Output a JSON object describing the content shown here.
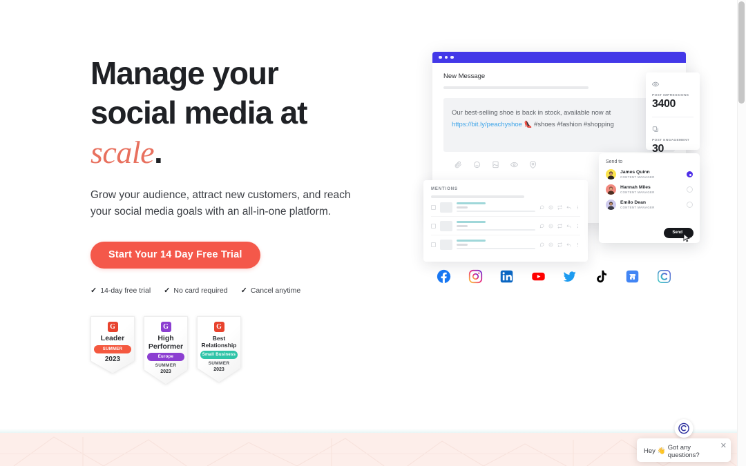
{
  "hero": {
    "headline_line1": "Manage your",
    "headline_line2": "social media at",
    "headline_accent": "scale",
    "headline_period": ".",
    "subhead": "Grow your audience, attract new customers, and reach your social media goals with an all-in-one platform.",
    "cta_label": "Start Your 14 Day Free Trial",
    "accent_color": "#f4584a",
    "accent_serif_color": "#e8705e",
    "trust_items": [
      {
        "check": "✓",
        "label": "14-day free trial"
      },
      {
        "check": "✓",
        "label": "No card required"
      },
      {
        "check": "✓",
        "label": "Cancel anytime"
      }
    ]
  },
  "badges": [
    {
      "mark": "G",
      "mark_color": "#e8432e",
      "title": "Leader",
      "title_size": "big",
      "ribbon": "SUMMER",
      "ribbon_color": "#f4583f",
      "sub": "",
      "year": "2023",
      "year_size": "lg"
    },
    {
      "mark": "G",
      "mark_color": "#8c3fd1",
      "title": "High\nPerformer",
      "title_size": "big",
      "ribbon": "Europe",
      "ribbon_color": "#8c3fd1",
      "sub": "SUMMER",
      "year": "2023",
      "year_size": "sm"
    },
    {
      "mark": "G",
      "mark_color": "#e8432e",
      "title": "Best\nRelationship",
      "title_size": "sm",
      "ribbon": "Small Business",
      "ribbon_color": "#2fc4a8",
      "sub": "SUMMER",
      "year": "2023",
      "year_size": "sm"
    }
  ],
  "mockup": {
    "titlebar_color": "#4338e8",
    "compose": {
      "label": "New Message",
      "message_text": "Our best-selling shoe is back in stock, available now at",
      "message_link": "https://bit.ly/peachyshoe",
      "message_emoji": "👠",
      "message_tags": "#shoes #fashion #shopping",
      "tools": [
        "attachment-icon",
        "emoji-icon",
        "image-icon",
        "preview-icon",
        "location-icon"
      ]
    },
    "stats": [
      {
        "icon": "eye-icon",
        "label": "POST IMPRESSIONS",
        "value": "3400"
      },
      {
        "icon": "engagement-icon",
        "label": "POST ENGAGEMENT",
        "value": "30"
      }
    ],
    "mentions": {
      "title": "MENTIONS",
      "rows": [
        {
          "actions": [
            "comment-icon",
            "like-icon",
            "retweet-icon",
            "reply-icon",
            "more-icon"
          ]
        },
        {
          "actions": [
            "comment-icon",
            "like-icon",
            "retweet-icon",
            "reply-icon",
            "more-icon"
          ]
        },
        {
          "actions": [
            "comment-icon",
            "like-icon",
            "retweet-icon",
            "reply-icon",
            "more-icon"
          ]
        }
      ]
    },
    "send_to": {
      "title": "Send to",
      "send_label": "Send",
      "contacts": [
        {
          "name": "James Quinn",
          "role": "CONTENT MANAGER",
          "avatar_color": "#fbe34d",
          "selected": true
        },
        {
          "name": "Hannah Miles",
          "role": "CONTENT MANAGER",
          "avatar_color": "#f2897f",
          "selected": false
        },
        {
          "name": "Emilo Dean",
          "role": "CONTENT MANAGER",
          "avatar_color": "#cfcbee",
          "selected": false
        }
      ]
    }
  },
  "social_networks": [
    {
      "name": "facebook-icon",
      "color": "#1877f2"
    },
    {
      "name": "instagram-icon",
      "color": "#e1306c"
    },
    {
      "name": "linkedin-icon",
      "color": "#0a66c2"
    },
    {
      "name": "youtube-icon",
      "color": "#ff0000"
    },
    {
      "name": "twitter-icon",
      "color": "#1d9bf0"
    },
    {
      "name": "tiktok-icon",
      "color": "#010101"
    },
    {
      "name": "google-business-icon",
      "color": "#4285f4"
    },
    {
      "name": "contentcal-icon",
      "color": "#32c5c0"
    }
  ],
  "chat_widget": {
    "greeting_prefix": "Hey",
    "greeting_emoji": "👋",
    "greeting_text": "Got any questions?",
    "close_label": "✕"
  }
}
